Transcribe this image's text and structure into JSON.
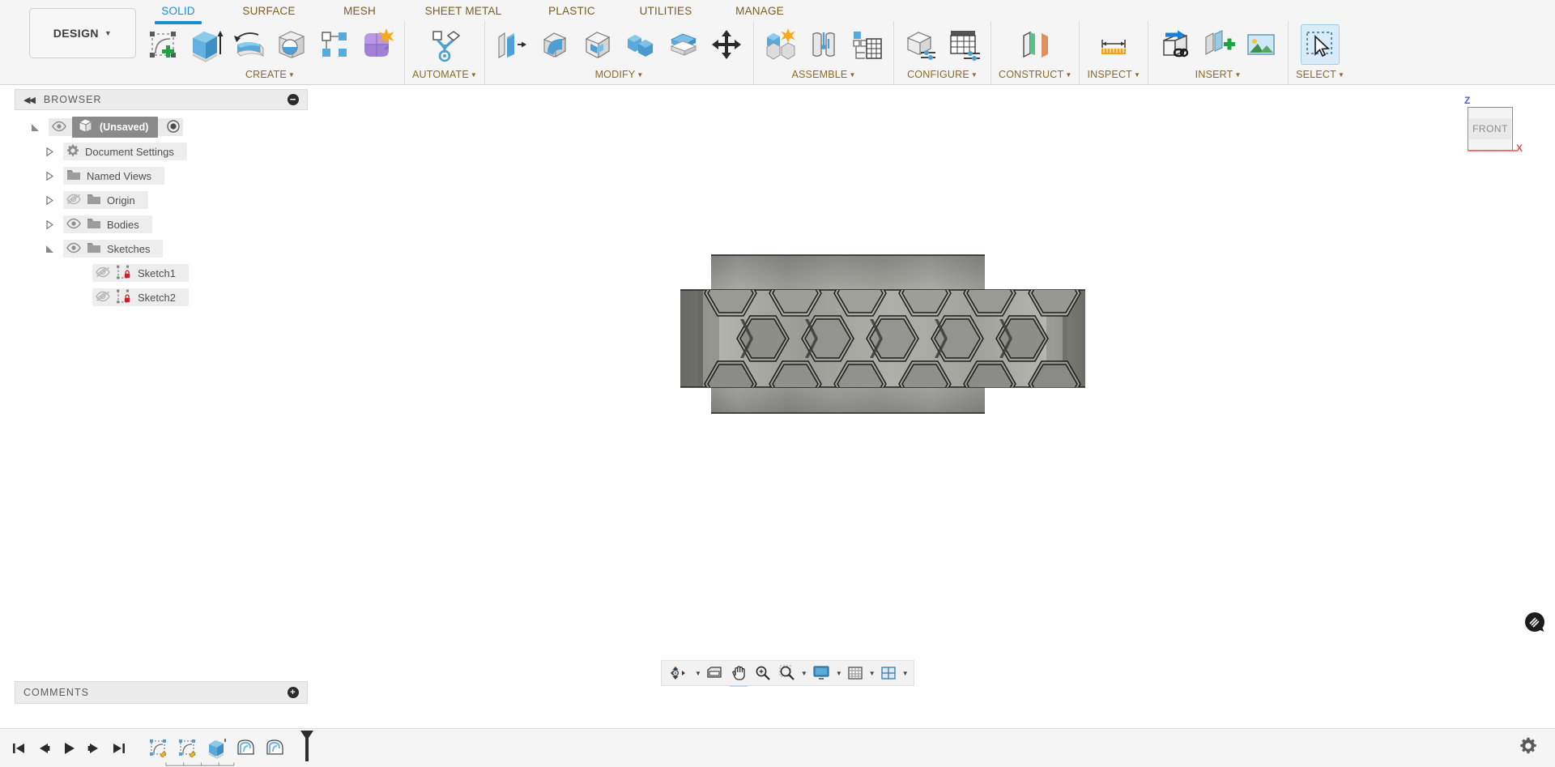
{
  "app": {
    "workspace_button": "DESIGN",
    "caret": "▾"
  },
  "ribbon": {
    "tabs": [
      {
        "label": "SOLID",
        "active": true
      },
      {
        "label": "SURFACE",
        "active": false
      },
      {
        "label": "MESH",
        "active": false
      },
      {
        "label": "SHEET METAL",
        "active": false
      },
      {
        "label": "PLASTIC",
        "active": false
      },
      {
        "label": "UTILITIES",
        "active": false
      },
      {
        "label": "MANAGE",
        "active": false
      }
    ],
    "panels": [
      {
        "label": "CREATE",
        "dropdown": true,
        "tools": [
          "create-sketch-icon",
          "extrude-icon",
          "revolve-icon",
          "sweep-icon",
          "pattern-icon",
          "form-icon"
        ]
      },
      {
        "label": "AUTOMATE",
        "dropdown": true,
        "tools": [
          "automate-icon"
        ]
      },
      {
        "label": "MODIFY",
        "dropdown": true,
        "tools": [
          "press-pull-icon",
          "fillet-icon",
          "shell-icon",
          "combine-icon",
          "split-face-icon",
          "move-copy-icon"
        ]
      },
      {
        "label": "ASSEMBLE",
        "dropdown": true,
        "tools": [
          "new-component-icon",
          "joint-icon",
          "bom-icon"
        ]
      },
      {
        "label": "CONFIGURE",
        "dropdown": true,
        "tools": [
          "configure-design-icon",
          "configure-table-icon"
        ]
      },
      {
        "label": "CONSTRUCT",
        "dropdown": true,
        "tools": [
          "offset-plane-icon"
        ]
      },
      {
        "label": "INSPECT",
        "dropdown": true,
        "tools": [
          "measure-icon"
        ]
      },
      {
        "label": "INSERT",
        "dropdown": true,
        "tools": [
          "insert-derive-icon",
          "insert-mcmaster-icon",
          "insert-canvas-icon"
        ]
      },
      {
        "label": "SELECT",
        "dropdown": true,
        "tools": [
          "select-window-icon"
        ]
      }
    ]
  },
  "browser": {
    "header": "BROWSER",
    "collapse_icon": "◀◀",
    "minus_icon": "−",
    "tree": [
      {
        "label": "(Unsaved)",
        "indent": 0,
        "expanded": true,
        "visible": true,
        "icon": "document-icon",
        "selected": true,
        "has_radio": true
      },
      {
        "label": "Document Settings",
        "indent": 1,
        "expanded": false,
        "visible": null,
        "icon": "gear-icon"
      },
      {
        "label": "Named Views",
        "indent": 1,
        "expanded": false,
        "visible": null,
        "icon": "folder-icon"
      },
      {
        "label": "Origin",
        "indent": 1,
        "expanded": false,
        "visible": false,
        "icon": "folder-icon"
      },
      {
        "label": "Bodies",
        "indent": 1,
        "expanded": false,
        "visible": true,
        "icon": "folder-icon"
      },
      {
        "label": "Sketches",
        "indent": 1,
        "expanded": true,
        "visible": true,
        "icon": "folder-icon"
      },
      {
        "label": "Sketch1",
        "indent": 2,
        "expanded": null,
        "visible": false,
        "icon": "sketch-locked-icon"
      },
      {
        "label": "Sketch2",
        "indent": 2,
        "expanded": null,
        "visible": false,
        "icon": "sketch-locked-icon"
      }
    ]
  },
  "comments": {
    "header": "COMMENTS",
    "plus_icon": "+"
  },
  "viewcube": {
    "face_label": "FRONT",
    "z_label": "Z",
    "x_label": "X"
  },
  "nav_toolbar": {
    "items": [
      {
        "name": "orbit-icon",
        "dropdown": true
      },
      {
        "name": "look-at-icon",
        "dropdown": false
      },
      {
        "name": "pan-icon",
        "dropdown": false
      },
      {
        "name": "zoom-icon",
        "dropdown": false
      },
      {
        "name": "zoom-window-icon",
        "dropdown": true
      },
      {
        "name": "display-settings-icon",
        "dropdown": true
      },
      {
        "name": "grid-snaps-icon",
        "dropdown": true
      },
      {
        "name": "viewports-icon",
        "dropdown": true
      }
    ]
  },
  "timeline": {
    "playback": [
      "go-to-beginning-icon",
      "step-back-icon",
      "play-icon",
      "step-forward-icon",
      "go-to-end-icon"
    ],
    "features": [
      "sketch-feature-icon",
      "sketch-feature-icon",
      "extrude-feature-icon",
      "extrude-cut-feature-icon",
      "extrude-cut-feature-icon"
    ],
    "marker": "timeline-marker",
    "settings_icon": "gear-icon"
  },
  "model": {
    "name": "hexagon-lattice-cylinder",
    "shading": "shaded-with-edges"
  },
  "colors": {
    "accent": "#1a8fd1",
    "panel_label": "#8a6a26",
    "ribbon_bg": "#f5f5f5",
    "browser_bg": "#ececec",
    "z_axis": "#4a5fd6",
    "x_axis": "#e05252"
  }
}
